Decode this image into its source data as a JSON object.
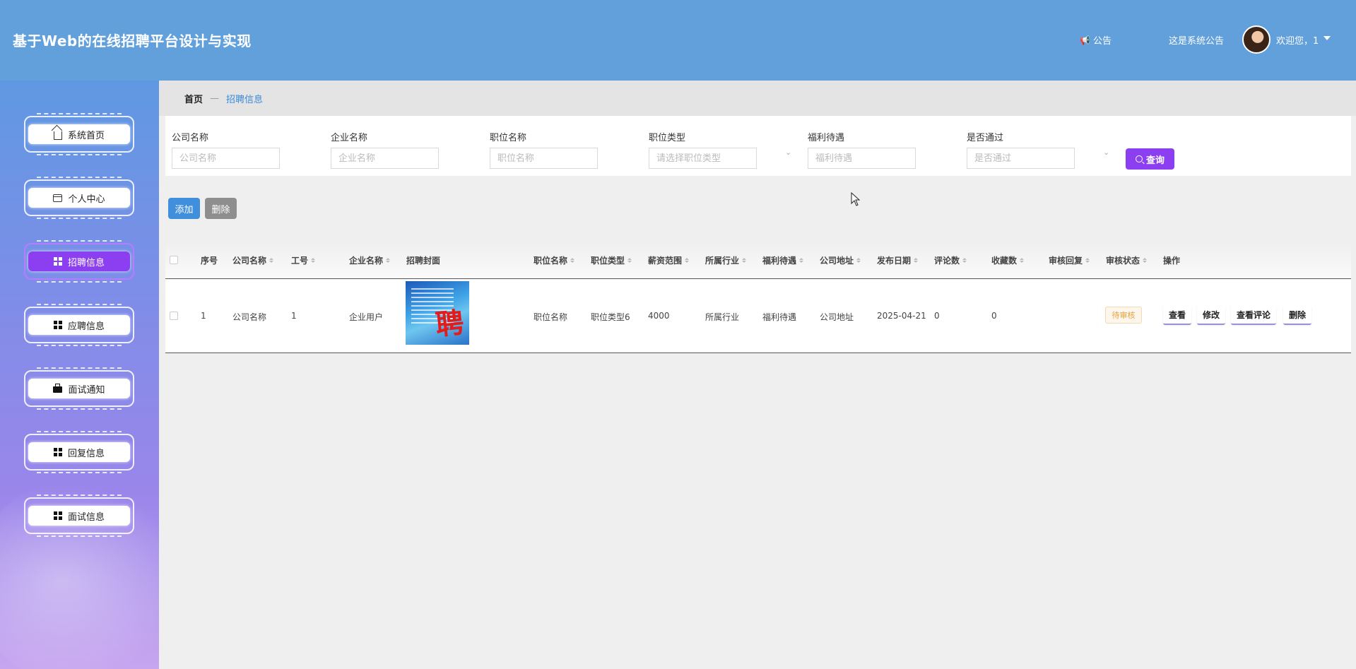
{
  "header": {
    "title": "基于Web的在线招聘平台设计与实现",
    "notice_label": "公告",
    "notice_text": "这是系统公告",
    "welcome": "欢迎您，1"
  },
  "sidebar": {
    "items": [
      {
        "label": "系统首页",
        "icon": "home-icon",
        "active": false
      },
      {
        "label": "个人中心",
        "icon": "card-icon",
        "active": false
      },
      {
        "label": "招聘信息",
        "icon": "grid-icon",
        "active": true
      },
      {
        "label": "应聘信息",
        "icon": "grid-icon",
        "active": false
      },
      {
        "label": "面试通知",
        "icon": "briefcase-icon",
        "active": false
      },
      {
        "label": "回复信息",
        "icon": "grid-icon",
        "active": false
      },
      {
        "label": "面试信息",
        "icon": "grid-icon",
        "active": false
      }
    ]
  },
  "breadcrumb": {
    "home": "首页",
    "separator": "—",
    "current": "招聘信息"
  },
  "search": {
    "fields": [
      {
        "label": "公司名称",
        "placeholder": "公司名称"
      },
      {
        "label": "企业名称",
        "placeholder": "企业名称"
      },
      {
        "label": "职位名称",
        "placeholder": "职位名称"
      },
      {
        "label": "职位类型",
        "placeholder": "请选择职位类型"
      },
      {
        "label": "福利待遇",
        "placeholder": "福利待遇"
      },
      {
        "label": "是否通过",
        "placeholder": "是否通过"
      }
    ],
    "query_label": "查询"
  },
  "actions": {
    "add_label": "添加",
    "delete_label": "删除"
  },
  "table": {
    "headers": [
      "序号",
      "公司名称",
      "工号",
      "企业名称",
      "招聘封面",
      "职位名称",
      "职位类型",
      "薪资范围",
      "所属行业",
      "福利待遇",
      "公司地址",
      "发布日期",
      "评论数",
      "收藏数",
      "审核回复",
      "审核状态",
      "操作"
    ],
    "rows": [
      {
        "index": "1",
        "company": "公司名称",
        "job_no": "1",
        "enterprise": "企业用户",
        "position": "职位名称",
        "position_type": "职位类型6",
        "salary": "4000",
        "industry": "所属行业",
        "welfare": "福利待遇",
        "address": "公司地址",
        "publish_date": "2025-04-21",
        "comments": "0",
        "favorites": "0",
        "review_reply": "",
        "status": "待审核",
        "ops": [
          "查看",
          "修改",
          "查看评论",
          "删除"
        ]
      }
    ]
  },
  "colors": {
    "header": "#62a0dc",
    "accent": "#8c3ff0",
    "primary": "#3f8fdc"
  }
}
